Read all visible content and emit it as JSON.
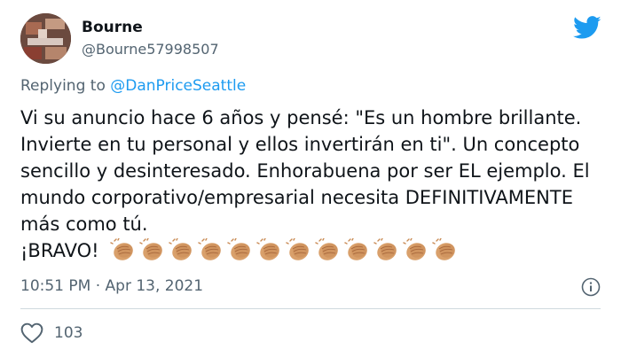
{
  "tweet": {
    "display_name": "Bourne",
    "handle": "@Bourne57998507",
    "replying_prefix": "Replying to",
    "replying_to": "@DanPriceSeattle",
    "lines": [
      "Vi su anuncio hace 6 años y pensé: \"Es un hombre brillante.",
      "Invierte en tu personal y ellos invertirán en ti\". Un concepto",
      "sencillo y desinteresado. Enhorabuena por ser EL ejemplo. El",
      "mundo corporativo/empresarial necesita DEFINITIVAMENTE",
      "más como tú."
    ],
    "final_text": "¡BRAVO!",
    "clap_count": 12,
    "clap_emoji_icon": "clapping-hands-icon",
    "time": "10:51 PM",
    "separator": "·",
    "date": "Apr 13, 2021",
    "likes_count": "103"
  },
  "colors": {
    "brand": "#1d9bf0",
    "text": "#0f1419",
    "muted": "#536471",
    "divider": "#cfd9de",
    "clap": "#d9a06b"
  }
}
